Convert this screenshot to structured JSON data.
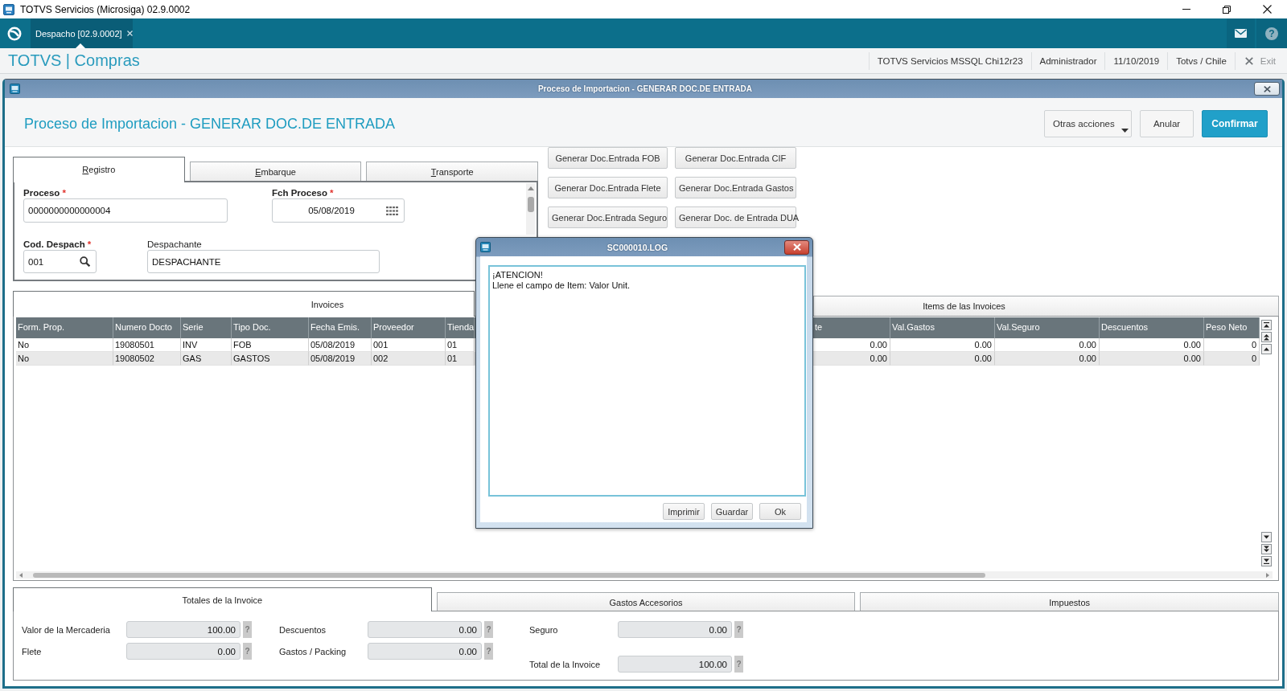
{
  "title_bar": {
    "title": "TOTVS Servicios (Microsiga) 02.9.0002"
  },
  "top_bar": {
    "tabs": [
      {
        "label": "Despacho [02.9.0002]",
        "selected": true
      }
    ],
    "help": "?"
  },
  "module_header": {
    "title": "TOTVS | Compras",
    "info": [
      "TOTVS Servicios MSSQL Chi12r23",
      "Administrador",
      "11/10/2019",
      "Totvs / Chile"
    ],
    "exit": "Exit"
  },
  "window": {
    "title": "Proceso de Importacion - GENERAR DOC.DE ENTRADA",
    "heading": "Proceso de Importacion - GENERAR DOC.DE ENTRADA",
    "actions": [
      {
        "label": "Otras acciones",
        "kind": "menu"
      },
      {
        "label": "Anular",
        "kind": "default"
      },
      {
        "label": "Confirmar",
        "kind": "primary"
      }
    ]
  },
  "form": {
    "tabs": [
      {
        "label": "Registro",
        "selected": true
      },
      {
        "label": "Embarque",
        "selected": false
      },
      {
        "label": "Transporte",
        "selected": false
      }
    ],
    "rows": [
      [
        {
          "label": "Proceso",
          "required_mark": "*",
          "kind": "text",
          "value": "0000000000000004"
        },
        {
          "label": "Fch Proceso",
          "required_mark": "*",
          "kind": "date",
          "value": "05/08/2019"
        }
      ],
      [
        {
          "label": "Cod. Despach",
          "required_mark": "*",
          "kind": "lookup",
          "value": "001"
        },
        {
          "label": "Despachante",
          "kind": "text",
          "value": "DESPACHANTE"
        }
      ]
    ]
  },
  "document_buttons": [
    "Generar Doc.Entrada FOB",
    "Generar Doc.Entrada CIF",
    "Generar Doc.Entrada Flete",
    "Generar Doc.Entrada Gastos",
    "Generar Doc.Entrada Seguro",
    "Generar Doc. de Entrada DUA"
  ],
  "invoices": {
    "tabs": [
      {
        "label": "Invoices",
        "selected": true
      },
      {
        "label": "Items de las Invoices",
        "selected": false
      }
    ],
    "table": {
      "columns": [
        "Form. Prop.",
        "Numero Docto",
        "Serie",
        "Tipo Doc.",
        "Fecha Emis.",
        "Proveedor",
        "Tienda",
        "te",
        "Val.Gastos",
        "Val.Seguro",
        "Descuentos",
        "Peso Neto"
      ],
      "rows": [
        {
          "cells": [
            "No",
            "19080501",
            "INV",
            "FOB",
            "05/08/2019",
            "001",
            "01",
            "0.00",
            "0.00",
            "0.00",
            "0.00",
            "0"
          ]
        },
        {
          "cells": [
            "No",
            "19080502",
            "GAS",
            "GASTOS",
            "05/08/2019",
            "002",
            "01",
            "0.00",
            "0.00",
            "0.00",
            "0.00",
            "0"
          ]
        }
      ]
    }
  },
  "totals": {
    "tabs": [
      {
        "label": "Totales de la Invoice",
        "selected": true
      },
      {
        "label": "Gastos Accesorios",
        "selected": false
      },
      {
        "label": "Impuestos",
        "selected": false
      }
    ],
    "groups": [
      {
        "fields": [
          {
            "label": "Valor de la Mercaderia",
            "value": "100.00",
            "disabled": true,
            "help": "?"
          },
          {
            "label": "Flete",
            "value": "0.00",
            "disabled": true,
            "help": "?"
          }
        ]
      },
      {
        "fields": [
          {
            "label": "Descuentos",
            "value": "0.00",
            "disabled": true,
            "help": "?"
          },
          {
            "label": "Gastos / Packing",
            "value": "0.00",
            "disabled": true,
            "help": "?"
          }
        ]
      },
      {
        "fields": [
          {
            "label": "Seguro",
            "value": "0.00",
            "disabled": true,
            "help": "?"
          },
          {
            "label": "Total de la Invoice",
            "value": "100.00",
            "disabled": true,
            "help": "?"
          }
        ]
      }
    ]
  },
  "dialog": {
    "title": "SC000010.LOG",
    "lines": [
      "¡ATENCION!",
      "Llene el campo de Item: Valor Unit."
    ],
    "buttons": [
      "Imprimir",
      "Guardar",
      "Ok"
    ]
  }
}
